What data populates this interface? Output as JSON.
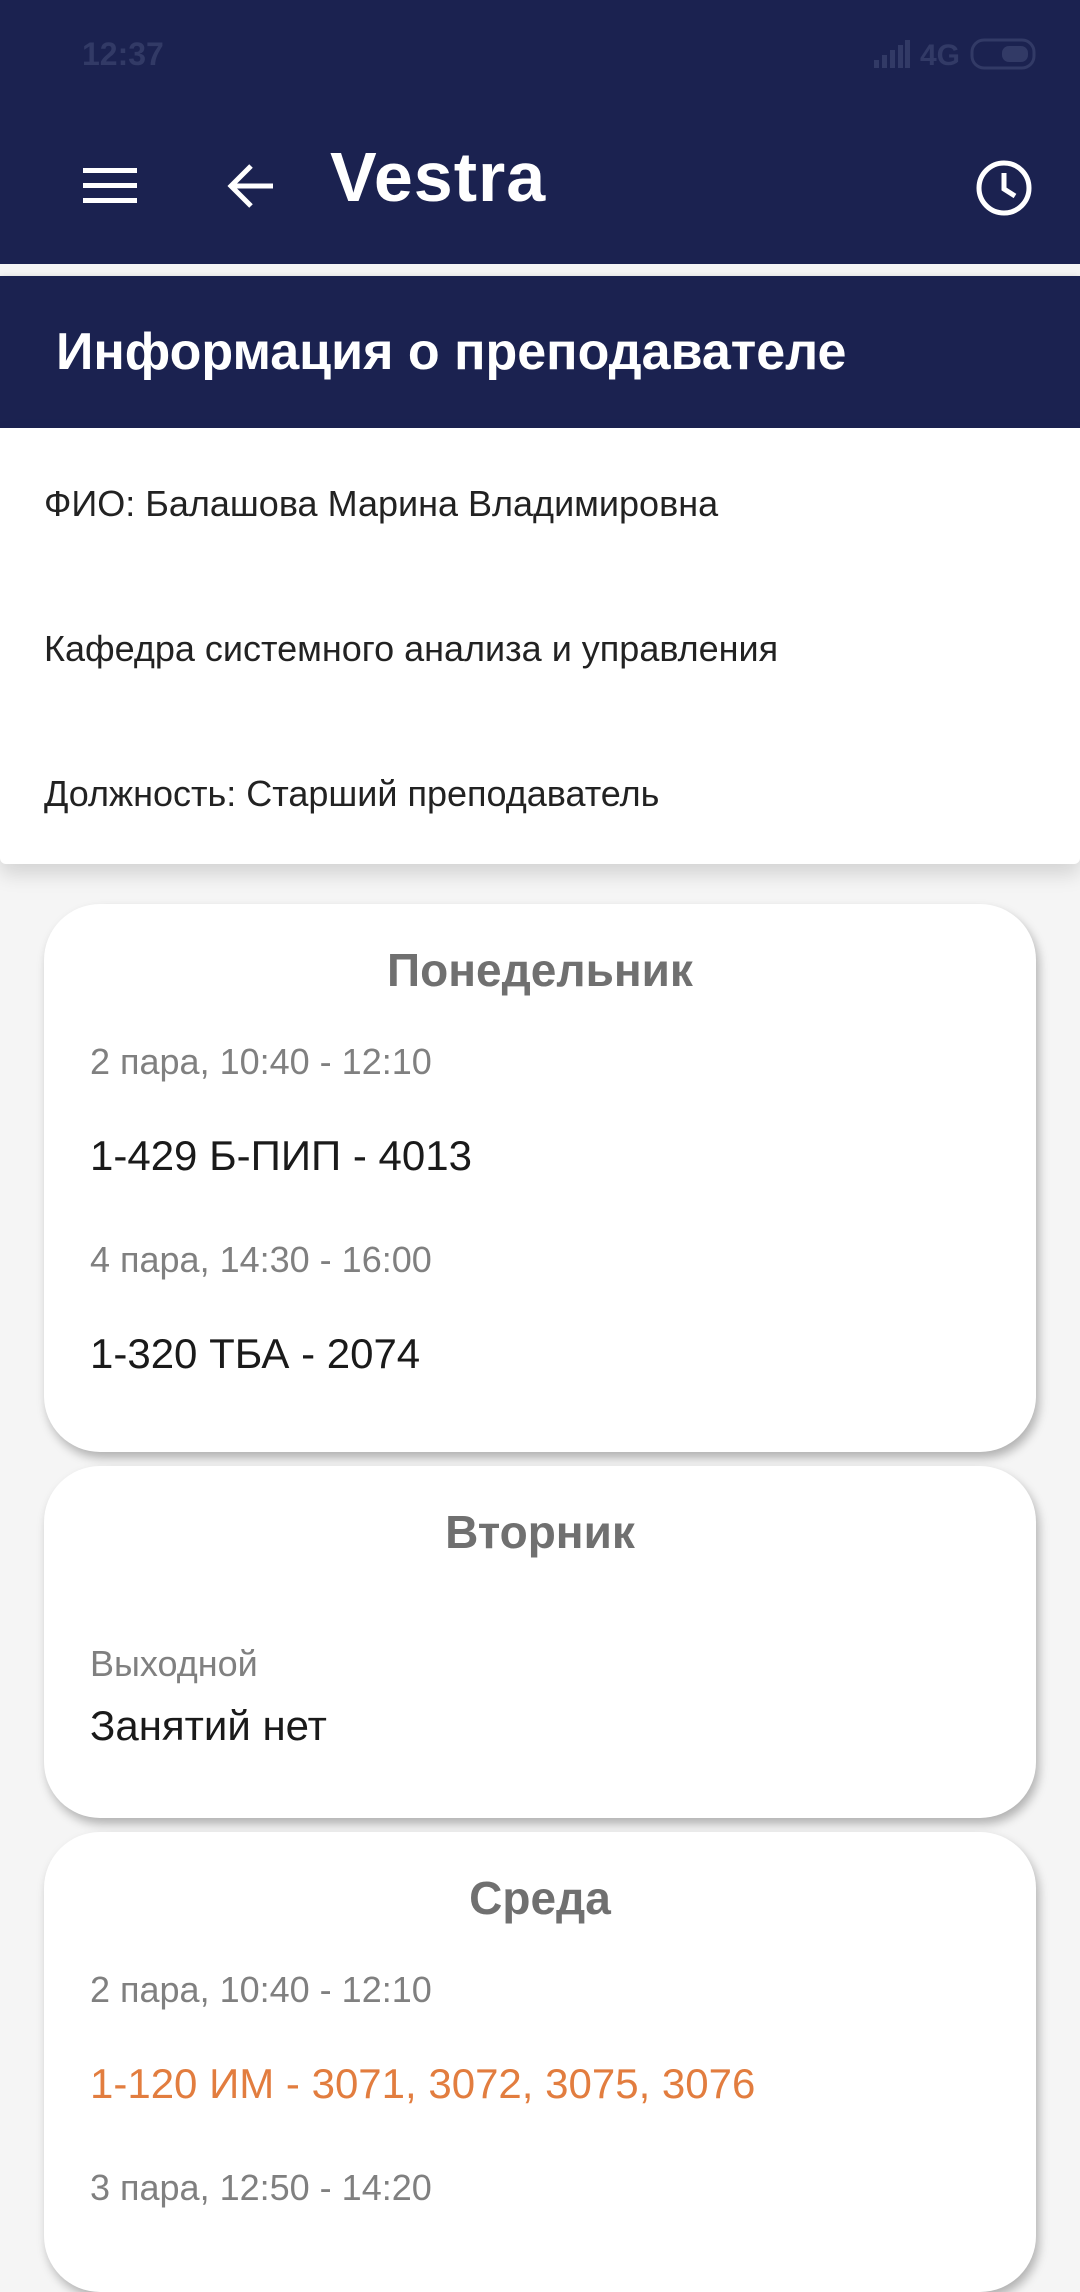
{
  "status_bar": {
    "time": "12:37",
    "network": "4G",
    "icons": [
      "signal-icon",
      "battery-icon"
    ]
  },
  "app_bar": {
    "title": "Vestra",
    "icons": [
      "menu-icon",
      "arrow-back-icon",
      "history-icon"
    ],
    "background_color": "#1b2250"
  },
  "header": {
    "title": "Информация о преподавателе"
  },
  "teacher": {
    "name_line": "ФИО: Балашова Марина Владимировна",
    "department": "Кафедра системного анализа и управления",
    "position_line": "Должность: Старший преподаватель"
  },
  "schedule": {
    "days": [
      {
        "name": "Понедельник",
        "slots": [
          {
            "time": "2 пара, 10:40 - 12:10",
            "class": "1-429 Б-ПИП - 4013"
          },
          {
            "time": "4 пара, 14:30 - 16:00",
            "class": "1-320 ТБА - 2074"
          }
        ]
      },
      {
        "name": "Вторник",
        "slots": [
          {
            "time": "Выходной",
            "class": "Занятий нет"
          }
        ]
      },
      {
        "name": "Среда",
        "slots": [
          {
            "time": "2 пара, 10:40 - 12:10",
            "class": "1-120 ИМ - 3071, 3072, 3075, 3076",
            "highlight_color": "#e27d3f"
          },
          {
            "time": "3 пара, 12:50 - 14:20",
            "class": ""
          }
        ]
      }
    ]
  }
}
